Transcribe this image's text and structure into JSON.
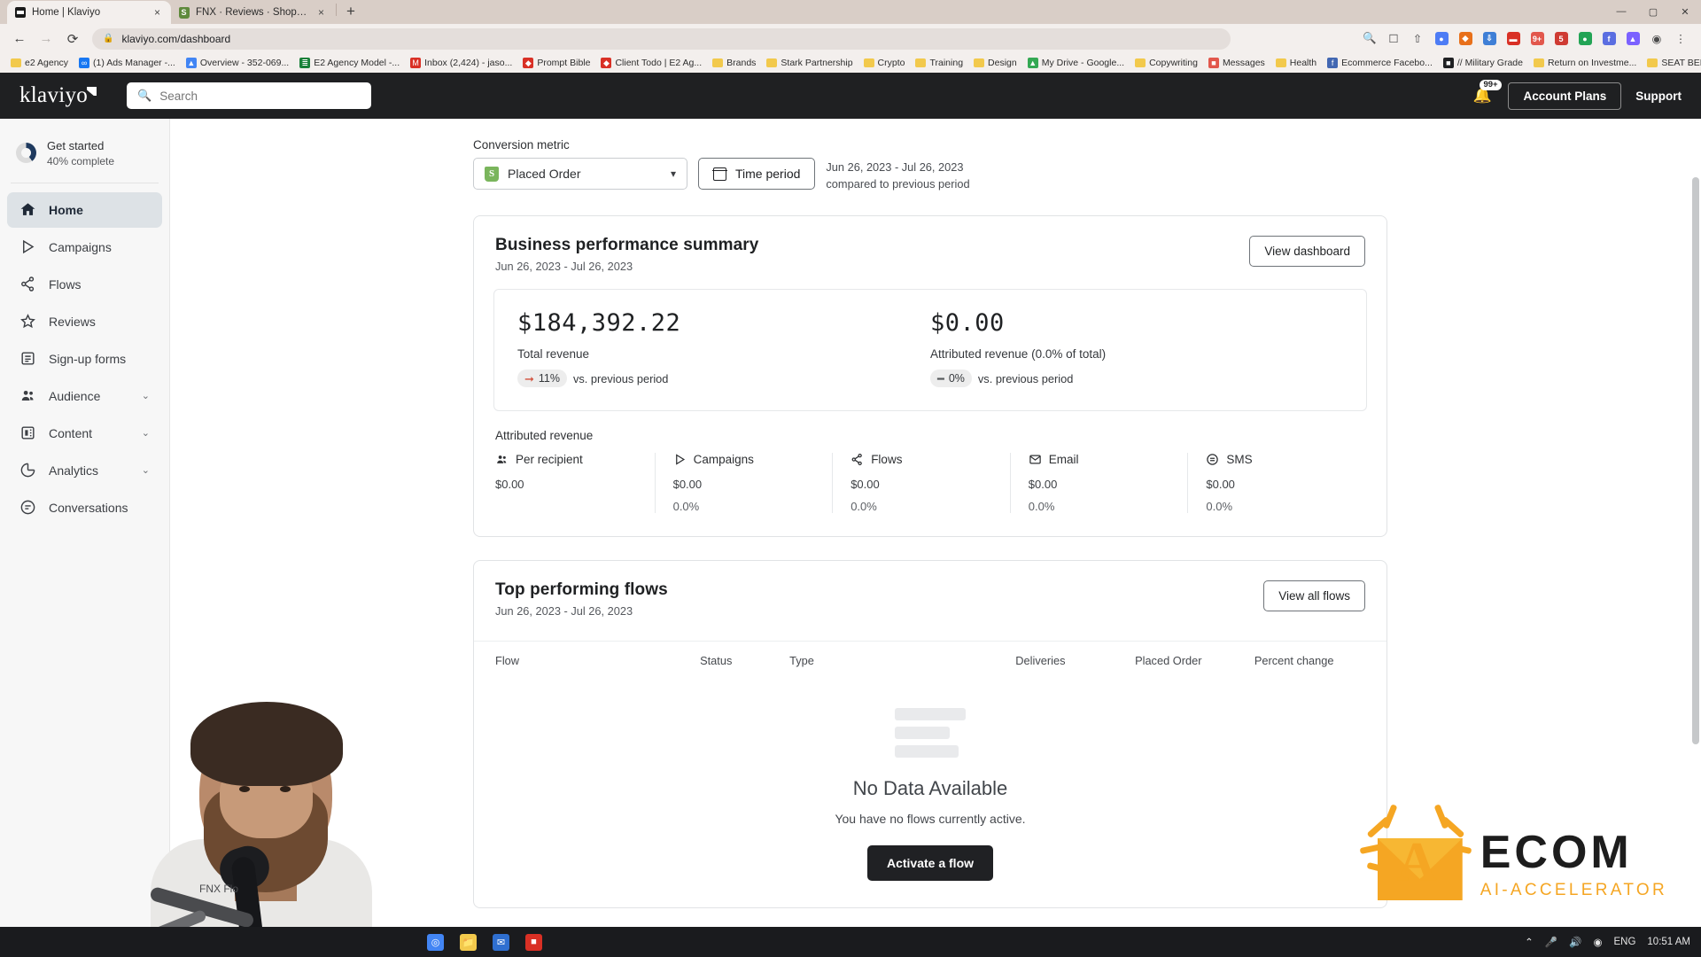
{
  "browser": {
    "tabs": [
      {
        "title": "Home | Klaviyo",
        "favicon": "klaviyo-icon",
        "active": true
      },
      {
        "title": "FNX · Reviews · Shopify Plus",
        "favicon": "shopify-icon",
        "active": false
      }
    ],
    "new_tab_label": "+",
    "close_label": "×",
    "window_controls": {
      "minimize": "—",
      "maximize": "▢",
      "close": "✕"
    },
    "nav": {
      "back": "←",
      "forward": "→",
      "reload": "⟳"
    },
    "address": {
      "lock_icon": "lock-icon",
      "url": "klaviyo.com/dashboard"
    },
    "toolbar_icons": [
      "zoom-icon",
      "save-icon",
      "share-icon",
      "extension-icon",
      "extension-icon",
      "extension-icon",
      "extension-icon",
      "extension-icon",
      "extension-icon",
      "extension-icon",
      "extension-icon",
      "extension-icon",
      "profile-icon",
      "menu-icon"
    ],
    "bookmarks": [
      {
        "label": "e2 Agency",
        "icon": "folder-icon"
      },
      {
        "label": "(1) Ads Manager -...",
        "icon": "meta-icon"
      },
      {
        "label": "Overview - 352-069...",
        "icon": "analytics-icon"
      },
      {
        "label": "E2 Agency Model -...",
        "icon": "sheets-icon"
      },
      {
        "label": "Inbox (2,424) - jaso...",
        "icon": "gmail-icon"
      },
      {
        "label": "Prompt Bible",
        "icon": "docs-icon"
      },
      {
        "label": "Client Todo | E2 Ag...",
        "icon": "docs-icon"
      },
      {
        "label": "Brands",
        "icon": "folder-icon"
      },
      {
        "label": "Stark Partnership",
        "icon": "folder-icon"
      },
      {
        "label": "Crypto",
        "icon": "folder-icon"
      },
      {
        "label": "Training",
        "icon": "folder-icon"
      },
      {
        "label": "Design",
        "icon": "folder-icon"
      },
      {
        "label": "My Drive - Google...",
        "icon": "drive-icon"
      },
      {
        "label": "Copywriting",
        "icon": "folder-icon"
      },
      {
        "label": "Messages",
        "icon": "messages-icon"
      },
      {
        "label": "Health",
        "icon": "folder-icon"
      },
      {
        "label": "Ecommerce Facebo...",
        "icon": "facebook-icon"
      },
      {
        "label": "// Military Grade",
        "icon": "dark-icon"
      },
      {
        "label": "Return on Investme...",
        "icon": "folder-icon"
      },
      {
        "label": "SEAT BELT BUCKLE...",
        "icon": "folder-icon"
      }
    ]
  },
  "header": {
    "logo": "klaviyo",
    "search_placeholder": "Search",
    "notification_badge": "99+",
    "account_plans_label": "Account Plans",
    "support_label": "Support"
  },
  "sidebar": {
    "get_started": {
      "title": "Get started",
      "progress_text": "40% complete",
      "progress_percent": 40
    },
    "items": [
      {
        "label": "Home",
        "icon": "home-icon",
        "active": true,
        "expandable": false
      },
      {
        "label": "Campaigns",
        "icon": "campaign-icon",
        "active": false,
        "expandable": false
      },
      {
        "label": "Flows",
        "icon": "flows-icon",
        "active": false,
        "expandable": false
      },
      {
        "label": "Reviews",
        "icon": "star-icon",
        "active": false,
        "expandable": false
      },
      {
        "label": "Sign-up forms",
        "icon": "form-icon",
        "active": false,
        "expandable": false
      },
      {
        "label": "Audience",
        "icon": "audience-icon",
        "active": false,
        "expandable": true
      },
      {
        "label": "Content",
        "icon": "content-icon",
        "active": false,
        "expandable": true
      },
      {
        "label": "Analytics",
        "icon": "analytics-icon",
        "active": false,
        "expandable": true
      },
      {
        "label": "Conversations",
        "icon": "conversations-icon",
        "active": false,
        "expandable": false
      }
    ],
    "chevron": "⌄"
  },
  "controls": {
    "conversion_metric_label": "Conversion metric",
    "metric_value": "Placed Order",
    "metric_icon": "shopify-icon",
    "time_period_label": "Time period",
    "date_range": "Jun 26, 2023 - Jul 26, 2023",
    "comparison": "compared to previous period"
  },
  "business_summary": {
    "title": "Business performance summary",
    "subtitle": "Jun 26, 2023 - Jul 26, 2023",
    "view_dashboard_label": "View dashboard",
    "metrics": [
      {
        "value": "$184,392.22",
        "label": "Total revenue",
        "delta": "11%",
        "delta_direction": "down",
        "delta_icon": "arrow-down-right-icon",
        "comparison": "vs. previous period"
      },
      {
        "value": "$0.00",
        "label": "Attributed revenue (0.0% of total)",
        "delta": "0%",
        "delta_direction": "flat",
        "delta_icon": "dash-icon",
        "comparison": "vs. previous period"
      }
    ],
    "attributed_revenue_title": "Attributed revenue",
    "attributed_revenue": [
      {
        "label": "Per recipient",
        "icon": "people-icon",
        "value": "$0.00",
        "percent": ""
      },
      {
        "label": "Campaigns",
        "icon": "campaign-icon",
        "value": "$0.00",
        "percent": "0.0%"
      },
      {
        "label": "Flows",
        "icon": "flows-icon",
        "value": "$0.00",
        "percent": "0.0%"
      },
      {
        "label": "Email",
        "icon": "email-icon",
        "value": "$0.00",
        "percent": "0.0%"
      },
      {
        "label": "SMS",
        "icon": "sms-icon",
        "value": "$0.00",
        "percent": "0.0%"
      }
    ]
  },
  "top_flows": {
    "title": "Top performing flows",
    "subtitle": "Jun 26, 2023 - Jul 26, 2023",
    "view_all_label": "View all flows",
    "columns": [
      "Flow",
      "Status",
      "Type",
      "Deliveries",
      "Placed Order",
      "Percent change"
    ],
    "empty_title": "No Data Available",
    "empty_subtitle": "You have no flows currently active.",
    "empty_cta": "Activate a flow"
  },
  "overlay": {
    "ecom_title": "ECOM",
    "ecom_subtitle": "AI-ACCELERATOR",
    "ecom_color": "#F5A623",
    "webcam_caption": "FNX Flo"
  },
  "taskbar": {
    "apps": [
      "chrome-icon",
      "folder-icon",
      "mail-icon",
      "app-icon"
    ],
    "tray": {
      "lang": "ENG",
      "time": "10:51 AM",
      "chevron": "⌃",
      "mic": "mic-icon",
      "volume": "volume-icon",
      "wifi": "wifi-icon"
    }
  }
}
